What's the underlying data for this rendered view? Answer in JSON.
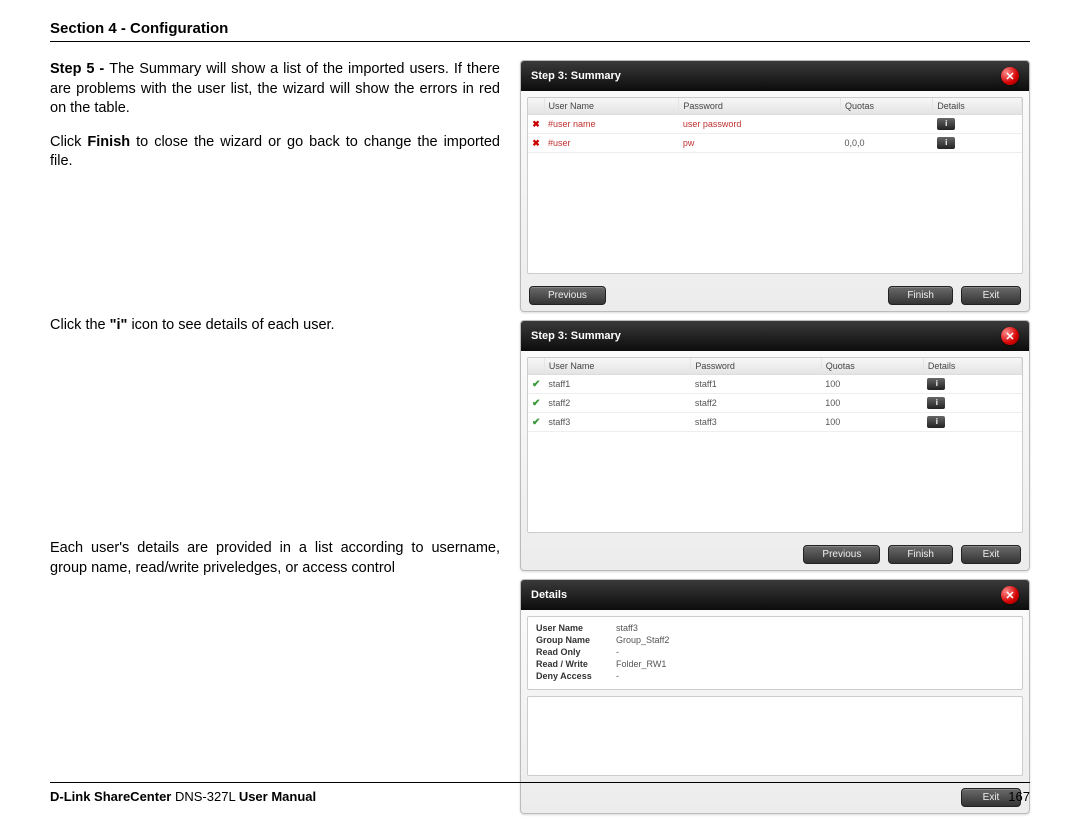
{
  "header": {
    "section": "Section 4 - Configuration"
  },
  "leftcol": {
    "p1_a": "Step 5 - ",
    "p1_b": "The Summary will show a list of the imported users. If there are problems with the user list, the wizard will show the errors in red on the table.",
    "p2_a": "Click ",
    "p2_b": "Finish",
    "p2_c": " to close the wizard or go back to change the imported file.",
    "p3_a": "Click the ",
    "p3_b": "\"i\"",
    "p3_c": " icon to see details of each user.",
    "p4": "Each user's details are provided in a list according to username, group name, read/write priveledges, or access control"
  },
  "panel1": {
    "title": "Step 3: Summary",
    "cols": [
      "",
      "User Name",
      "Password",
      "Quotas",
      "Details"
    ],
    "rows": [
      {
        "status": "x",
        "user": "#user name",
        "pw": "user password",
        "quota": "",
        "err": true
      },
      {
        "status": "x",
        "user": "#user",
        "pw": "pw",
        "quota": "0,0,0",
        "err": true
      }
    ],
    "buttons": {
      "prev": "Previous",
      "finish": "Finish",
      "exit": "Exit"
    }
  },
  "panel2": {
    "title": "Step 3: Summary",
    "cols": [
      "",
      "User Name",
      "Password",
      "Quotas",
      "Details"
    ],
    "rows": [
      {
        "status": "ok",
        "user": "staff1",
        "pw": "staff1",
        "quota": "100"
      },
      {
        "status": "ok",
        "user": "staff2",
        "pw": "staff2",
        "quota": "100"
      },
      {
        "status": "ok",
        "user": "staff3",
        "pw": "staff3",
        "quota": "100"
      }
    ],
    "buttons": {
      "prev": "Previous",
      "finish": "Finish",
      "exit": "Exit"
    }
  },
  "panel3": {
    "title": "Details",
    "fields": [
      {
        "k": "User Name",
        "v": "staff3"
      },
      {
        "k": "Group Name",
        "v": "Group_Staff2"
      },
      {
        "k": "Read Only",
        "v": "-"
      },
      {
        "k": "Read / Write",
        "v": "Folder_RW1"
      },
      {
        "k": "Deny Access",
        "v": "-"
      }
    ],
    "buttons": {
      "exit": "Exit"
    }
  },
  "footer": {
    "product_a": "D-Link ShareCenter",
    "product_b": " DNS-327L ",
    "product_c": "User Manual",
    "page": "167"
  }
}
